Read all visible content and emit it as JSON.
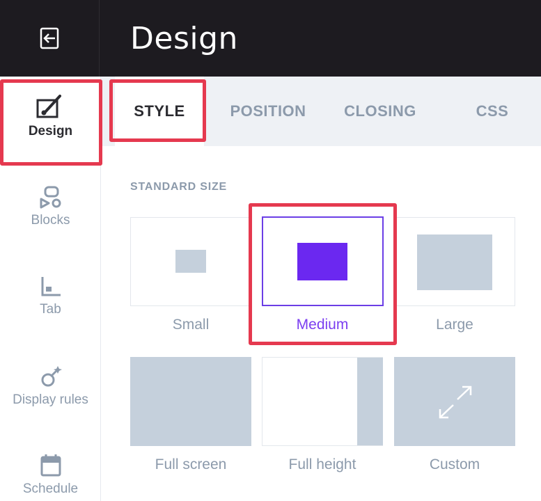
{
  "header": {
    "title": "Design"
  },
  "sidebar": {
    "items": [
      {
        "label": "Design",
        "icon": "brush-frame-icon",
        "active": true
      },
      {
        "label": "Blocks",
        "icon": "blocks-icon"
      },
      {
        "label": "Tab",
        "icon": "tab-icon"
      },
      {
        "label": "Display rules",
        "icon": "display-rules-icon"
      },
      {
        "label": "Schedule",
        "icon": "calendar-icon"
      }
    ]
  },
  "tabs": [
    {
      "label": "STYLE",
      "active": true
    },
    {
      "label": "POSITION"
    },
    {
      "label": "CLOSING"
    },
    {
      "label": "CSS"
    }
  ],
  "section": {
    "label": "STANDARD SIZE"
  },
  "size_options": [
    {
      "label": "Small"
    },
    {
      "label": "Medium",
      "selected": true
    },
    {
      "label": "Large"
    },
    {
      "label": "Full screen"
    },
    {
      "label": "Full height"
    },
    {
      "label": "Custom"
    }
  ],
  "colors": {
    "accent": "#6b28f0",
    "highlight": "#e5394f",
    "topbar": "#1d1b20",
    "muted": "#8c9aab",
    "placeholder": "#c5d0dc"
  }
}
